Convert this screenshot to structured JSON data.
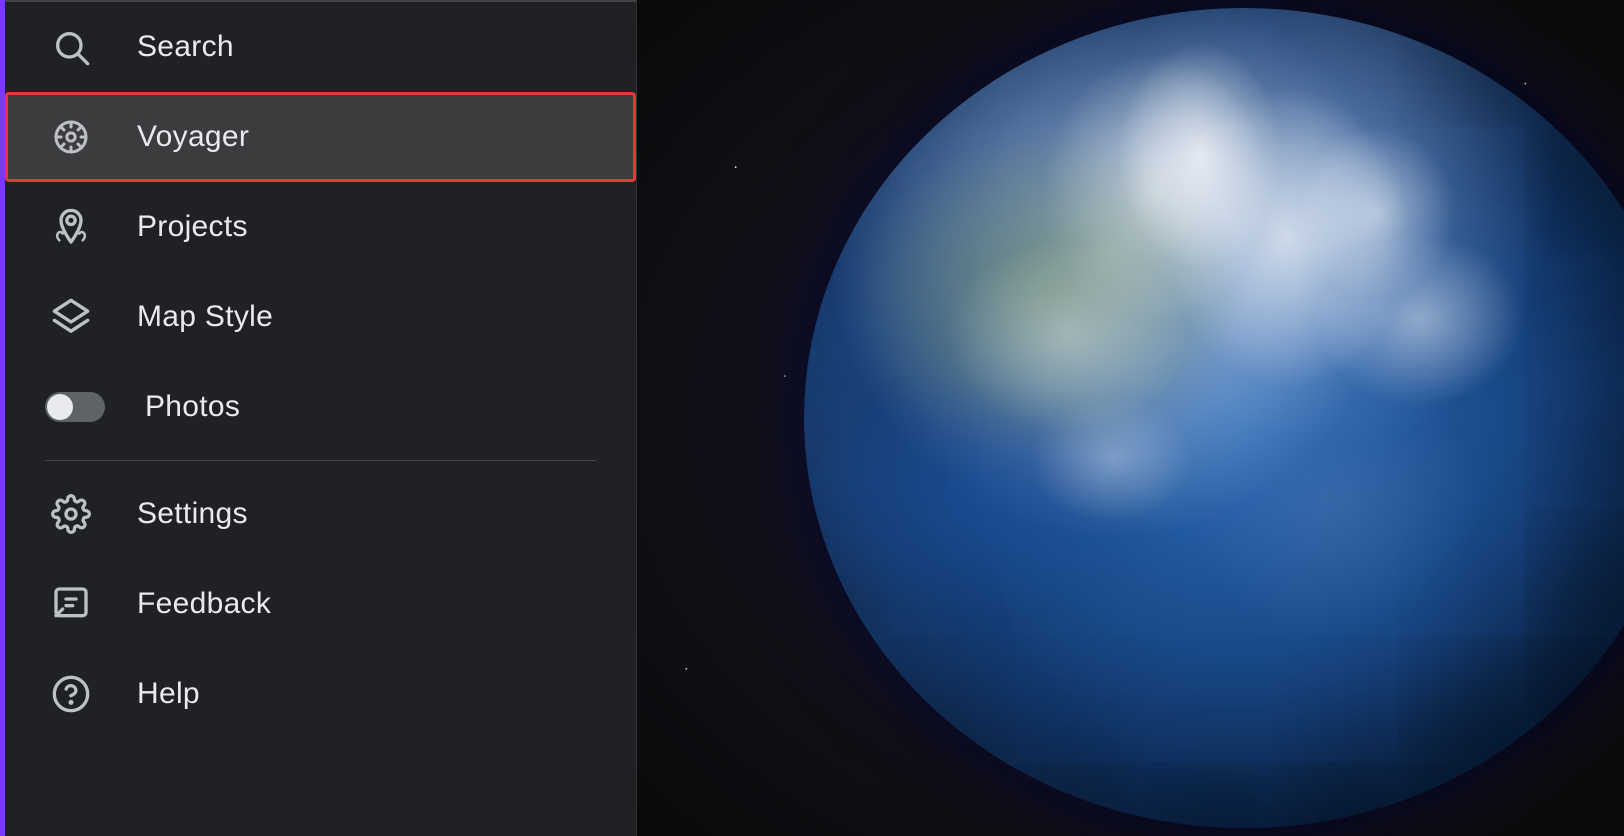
{
  "sidebar": {
    "items": [
      {
        "id": "search",
        "label": "Search",
        "icon": "search-icon",
        "active": false
      },
      {
        "id": "voyager",
        "label": "Voyager",
        "icon": "voyager-icon",
        "active": true
      },
      {
        "id": "projects",
        "label": "Projects",
        "icon": "projects-icon",
        "active": false
      },
      {
        "id": "map-style",
        "label": "Map Style",
        "icon": "layers-icon",
        "active": false
      },
      {
        "id": "photos",
        "label": "Photos",
        "icon": "photos-toggle",
        "active": false
      },
      {
        "id": "settings",
        "label": "Settings",
        "icon": "settings-icon",
        "active": false
      },
      {
        "id": "feedback",
        "label": "Feedback",
        "icon": "feedback-icon",
        "active": false
      },
      {
        "id": "help",
        "label": "Help",
        "icon": "help-icon",
        "active": false
      }
    ]
  },
  "colors": {
    "accent_bar": "#7c3aed",
    "active_outline": "#e53935",
    "sidebar_bg": "#202124",
    "active_item_bg": "#3c3c3e"
  }
}
